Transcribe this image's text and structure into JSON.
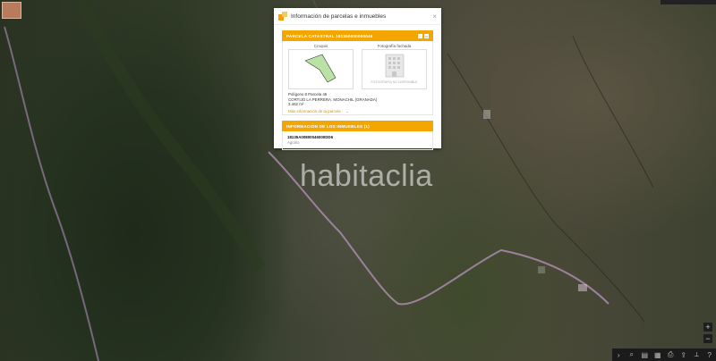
{
  "map": {
    "watermark": "habitaclia",
    "topright_text": "",
    "zoom_in_label": "+",
    "zoom_out_label": "−",
    "toolbar_icons": [
      "chevron-right-icon",
      "search-icon",
      "layers-icon",
      "table-icon",
      "print-icon",
      "share-icon",
      "ruler-icon",
      "help-icon"
    ]
  },
  "panel": {
    "title": "Información de parcelas e inmuebles",
    "close_label": "×",
    "parcel_header": "PARCELA CATASTRAL 181350000000046",
    "croquis_label": "Croquis",
    "photo_label": "Fotografía fachada",
    "photo_placeholder": "FOTOGRAFÍA NO DISPONIBLE",
    "location_line1": "Polígono 8 Parcela 46",
    "location_line2": "CORTIJO LA PERRERA. MONACHIL (GRANADA)",
    "area": "3.462 m²",
    "more_info_label": "Más información de la parcela",
    "immuebles_header": "INFORMACIÓN DE LOS INMUEBLES (1)",
    "immueble_ref": "18135A00800046000DD6",
    "immueble_use": "Agrario"
  },
  "colors": {
    "accent": "#f3a600",
    "parcel_fill": "#b9e2a4"
  }
}
